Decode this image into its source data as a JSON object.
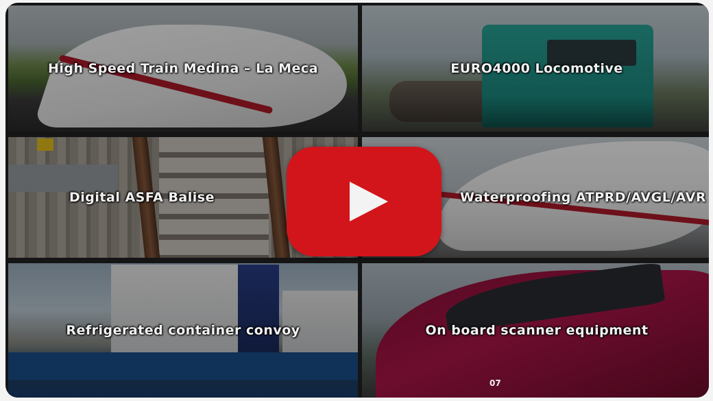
{
  "video": {
    "play_button_label": "Play",
    "play_icon": "play-icon",
    "play_color": "#d2151b"
  },
  "tiles": [
    {
      "caption": "High Speed Train Medina – La Meca"
    },
    {
      "caption": "EURO4000 Locomotive"
    },
    {
      "caption": "Digital ASFA Balise"
    },
    {
      "caption": "Waterproofing ATPRD/AVGL/AVR"
    },
    {
      "caption": "Refrigerated container convoy"
    },
    {
      "caption": "On board scanner equipment"
    }
  ],
  "tile6_number": "07"
}
